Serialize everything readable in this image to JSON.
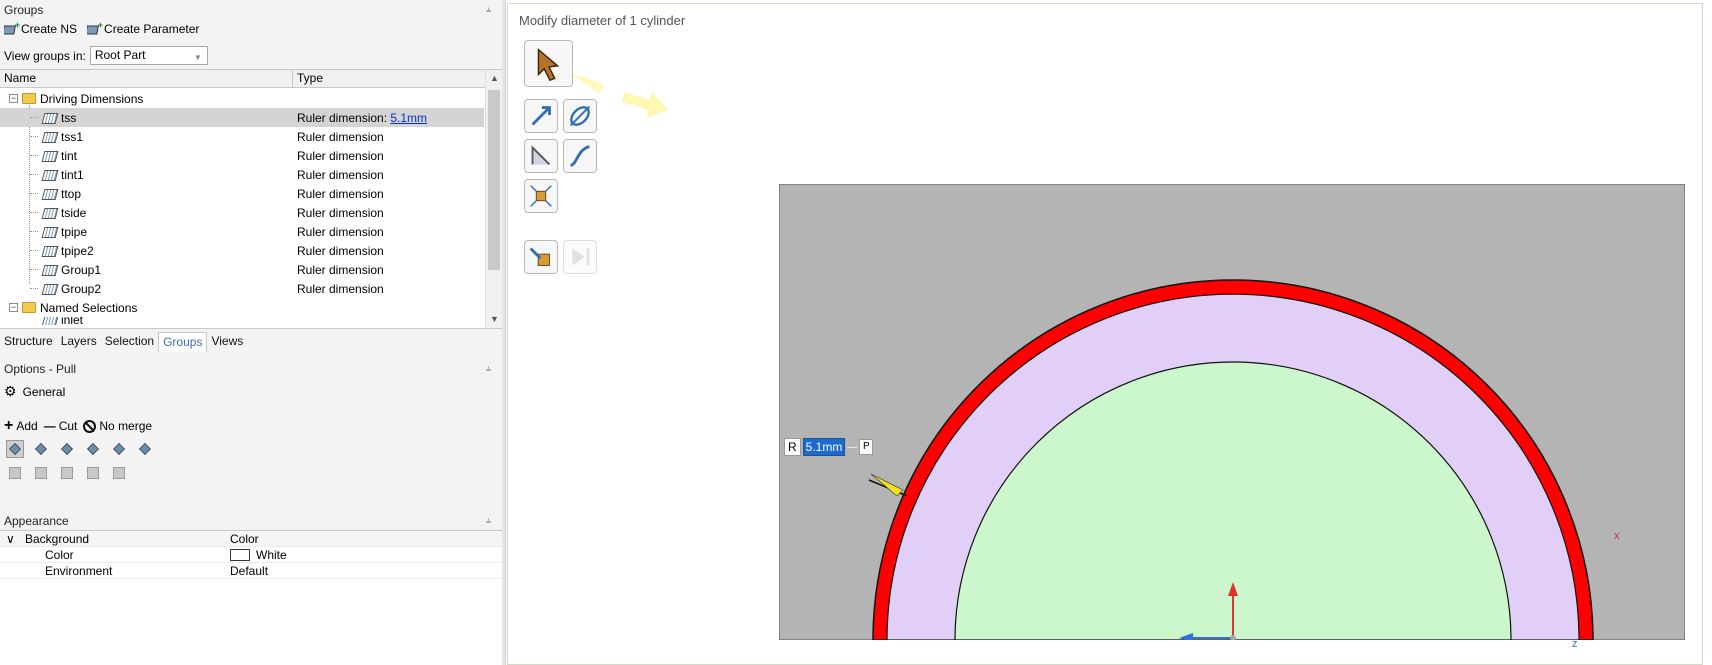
{
  "groups_panel": {
    "title": "Groups",
    "create_ns": "Create NS",
    "create_parameter": "Create Parameter",
    "view_groups_label": "View groups in:",
    "view_groups_value": "Root Part",
    "columns": {
      "name": "Name",
      "type": "Type"
    },
    "driving_folder": "Driving Dimensions",
    "rows": [
      {
        "name": "tss",
        "type": "Ruler dimension: ",
        "link": "5.1mm"
      },
      {
        "name": "tss1",
        "type": "Ruler dimension"
      },
      {
        "name": "tint",
        "type": "Ruler dimension"
      },
      {
        "name": "tint1",
        "type": "Ruler dimension"
      },
      {
        "name": "ttop",
        "type": "Ruler dimension"
      },
      {
        "name": "tside",
        "type": "Ruler dimension"
      },
      {
        "name": "tpipe",
        "type": "Ruler dimension"
      },
      {
        "name": "tpipe2",
        "type": "Ruler dimension"
      },
      {
        "name": "Group1",
        "type": "Ruler dimension"
      },
      {
        "name": "Group2",
        "type": "Ruler dimension"
      }
    ],
    "named_folder": "Named Selections",
    "partial_row": "inlet"
  },
  "tabs": [
    "Structure",
    "Layers",
    "Selection",
    "Groups",
    "Views"
  ],
  "active_tab": "Groups",
  "options_panel": {
    "title": "Options - Pull",
    "general": "General",
    "add": "Add",
    "cut": "Cut",
    "no_merge": "No merge"
  },
  "appearance_panel": {
    "title": "Appearance",
    "background_label": "Background",
    "background_value": "Color",
    "color_label": "Color",
    "color_value": "White",
    "environment_label": "Environment",
    "environment_value": "Default"
  },
  "viewport": {
    "title": "Modify diameter of 1 cylinder",
    "radius_prefix": "R",
    "radius_value": "5.1mm",
    "axis_x": "x",
    "axis_z": "z"
  },
  "colors": {
    "outer_ring": "#ff0000",
    "middle_ring": "#e1cff8",
    "inner_core": "#ccf7cc",
    "background": "#b4b4b4",
    "selection_accent": "#3b6fb6"
  }
}
